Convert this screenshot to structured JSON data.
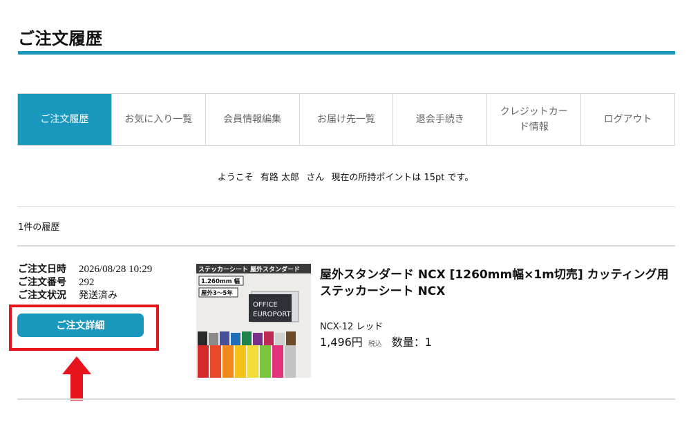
{
  "page": {
    "title": "ご注文履歴"
  },
  "tabs": [
    {
      "label": "ご注文履歴"
    },
    {
      "label": "お気に入り一覧"
    },
    {
      "label": "会員情報編集"
    },
    {
      "label": "お届け先一覧"
    },
    {
      "label": "退会手続き"
    },
    {
      "label": "クレジットカード情報"
    },
    {
      "label": "ログアウト"
    }
  ],
  "welcome": {
    "prefix": "ようこそ",
    "name": "有路 太郎",
    "honorific": "さん",
    "points_text": "現在の所持ポイントは 15pt です。"
  },
  "history": {
    "count_text": "1件の履歴"
  },
  "order": {
    "date_label": "ご注文日時",
    "date_value": "2026/08/28 10:29",
    "number_label": "ご注文番号",
    "number_value": "292",
    "status_label": "ご注文状況",
    "status_value": "発送済み",
    "detail_button": "ご注文詳細"
  },
  "product": {
    "name": "屋外スタンダード NCX [1260mm幅×1m切売] カッティング用ステッカーシート NCX",
    "variant": "NCX-12 レッド",
    "price": "1,496円",
    "tax_label": "税込",
    "quantity": "数量：1",
    "image": {
      "header_text": "ステッカーシート 屋外スタンダード",
      "width_badge": "1.260mm 幅",
      "years_badge": "屋外3～5年",
      "sign_line1": "OFFICE",
      "sign_line2": "EUROPORT"
    }
  },
  "colors": {
    "accent": "#1a97bd",
    "highlight": "#e8141b"
  }
}
